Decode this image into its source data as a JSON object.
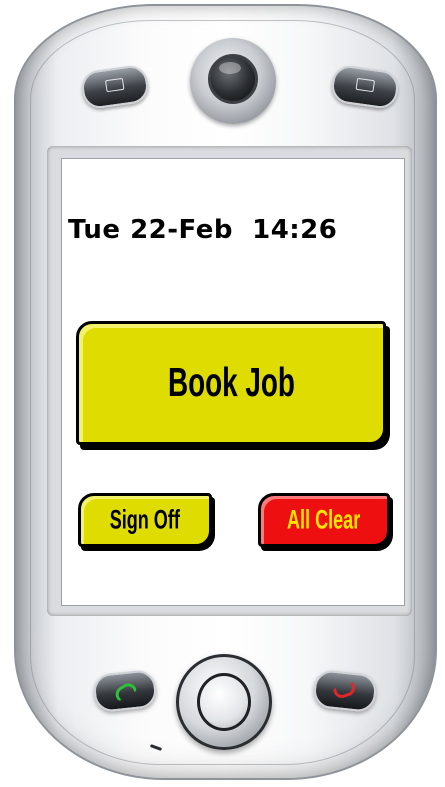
{
  "status": {
    "datetime": "Tue 22-Feb  14:26"
  },
  "actions": {
    "book_job": "Book Job",
    "sign_off": "Sign Off",
    "all_clear": "All Clear"
  },
  "colors": {
    "book_job_bg": "#dedc00",
    "sign_off_bg": "#dedc00",
    "all_clear_bg": "#ee1010",
    "all_clear_text": "#ffe800"
  },
  "device": {
    "top_left_key_icon": "calendar-icon",
    "top_right_key_icon": "contacts-icon",
    "call_key_icon": "phone-call-icon",
    "end_call_key_icon": "phone-end-icon"
  }
}
